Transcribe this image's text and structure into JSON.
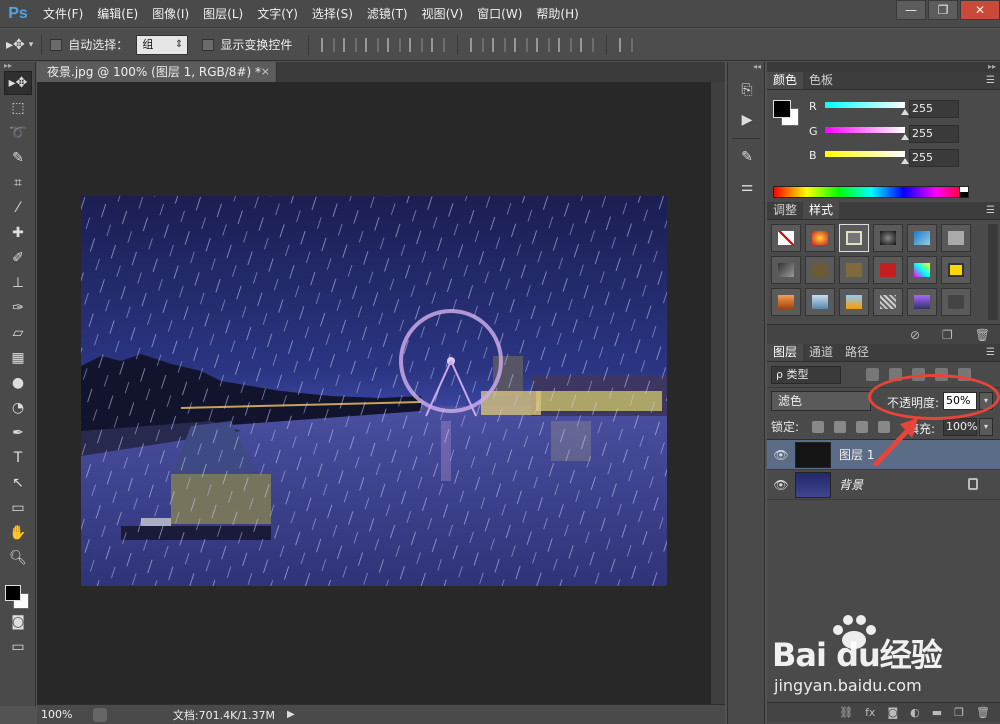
{
  "app": {
    "logo": "Ps",
    "menu": [
      "文件(F)",
      "编辑(E)",
      "图像(I)",
      "图层(L)",
      "文字(Y)",
      "选择(S)",
      "滤镜(T)",
      "视图(V)",
      "窗口(W)",
      "帮助(H)"
    ]
  },
  "options": {
    "auto_select_label": "自动选择：",
    "auto_select_value": "组",
    "show_transform_label": "显示变换控件"
  },
  "document": {
    "tab_title": "夜景.jpg @ 100% (图层 1, RGB/8#) *",
    "close": "×"
  },
  "status": {
    "zoom": "100%",
    "doc_info": "文档:701.4K/1.37M"
  },
  "color_panel": {
    "tabs": [
      "颜色",
      "色板"
    ],
    "r_label": "R",
    "g_label": "G",
    "b_label": "B",
    "r_value": "255",
    "g_value": "255",
    "b_value": "255"
  },
  "styles_panel": {
    "tabs": [
      "调整",
      "样式"
    ]
  },
  "layers_panel": {
    "tabs": [
      "图层",
      "通道",
      "路径"
    ],
    "filter_value": "ρ 类型",
    "blend_mode": "滤色",
    "opacity_label": "不透明度:",
    "opacity_value": "50%",
    "lock_label": "锁定:",
    "fill_label": "填充:",
    "fill_value": "100%",
    "layers": [
      {
        "name": "图层 1",
        "selected": true,
        "locked": false
      },
      {
        "name": "背景",
        "selected": false,
        "locked": true
      }
    ]
  },
  "watermark": {
    "brand": "Bai du经验",
    "url": "jingyan.baidu.com"
  },
  "colors": {
    "accent_red": "#e8443a",
    "selected_layer": "#5b6c86"
  }
}
